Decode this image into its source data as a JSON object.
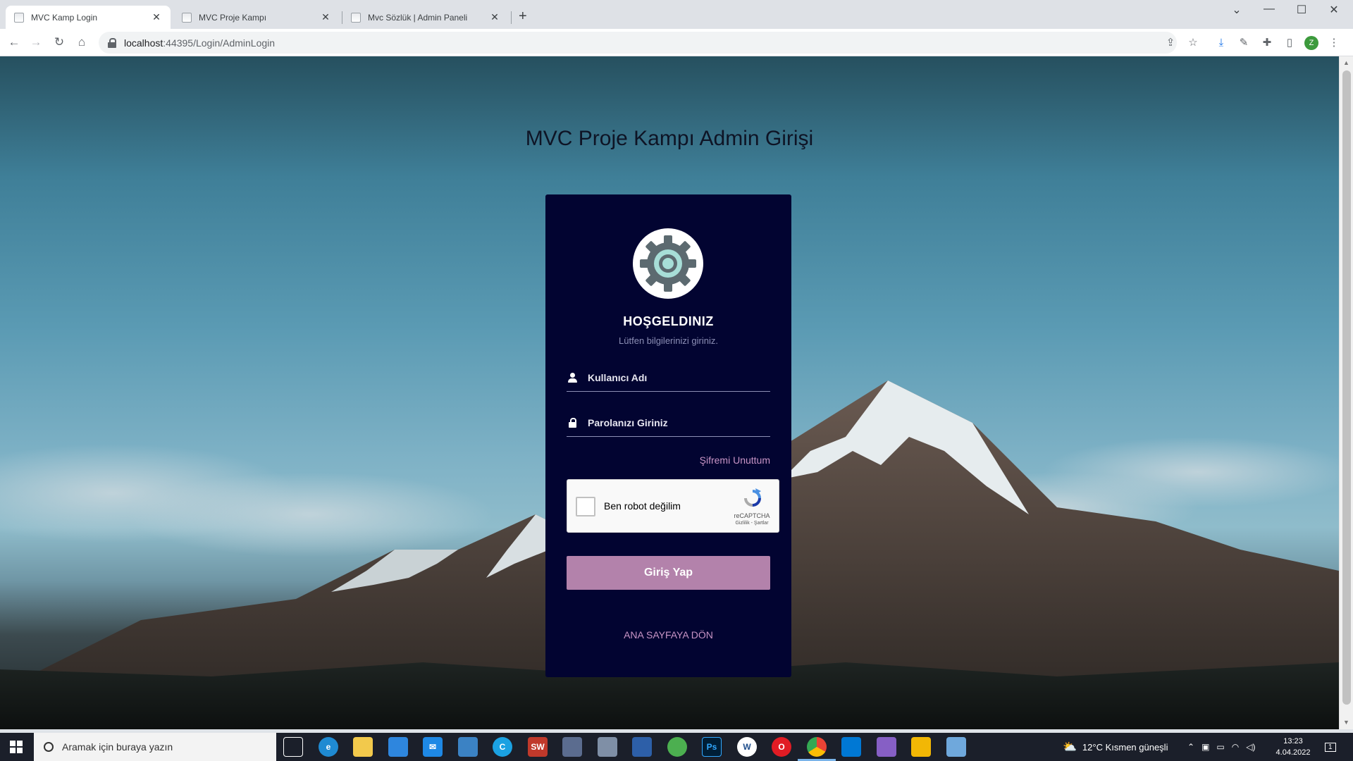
{
  "browser": {
    "tabs": [
      {
        "title": "MVC Kamp Login",
        "active": true
      },
      {
        "title": "MVC Proje Kampı",
        "active": false
      },
      {
        "title": "Mvc Sözlük | Admin Paneli",
        "active": false
      }
    ],
    "url_host": "localhost",
    "url_path": ":44395/Login/AdminLogin",
    "profile_initial": "Z"
  },
  "page": {
    "title": "MVC Proje Kampı Admin Girişi",
    "welcome": "HOŞGELDINIZ",
    "subtitle": "Lütfen bilgilerinizi giriniz.",
    "username_placeholder": "Kullanıcı Adı",
    "password_placeholder": "Parolanızı Giriniz",
    "forgot_link": "Şifremi Unuttum",
    "recaptcha": {
      "label": "Ben robot değilim",
      "brand": "reCAPTCHA",
      "terms": "Gizlilik - Şartlar"
    },
    "submit_label": "Giriş Yap",
    "home_link": "ANA SAYFAYA DÖN"
  },
  "taskbar": {
    "search_placeholder": "Aramak için buraya yazın",
    "weather": "12°C  Kısmen güneşli",
    "time": "13:23",
    "date": "4.04.2022",
    "notification_count": "1"
  },
  "colors": {
    "card_bg": "#020431",
    "accent": "#b382ab",
    "link": "#c894c5"
  }
}
